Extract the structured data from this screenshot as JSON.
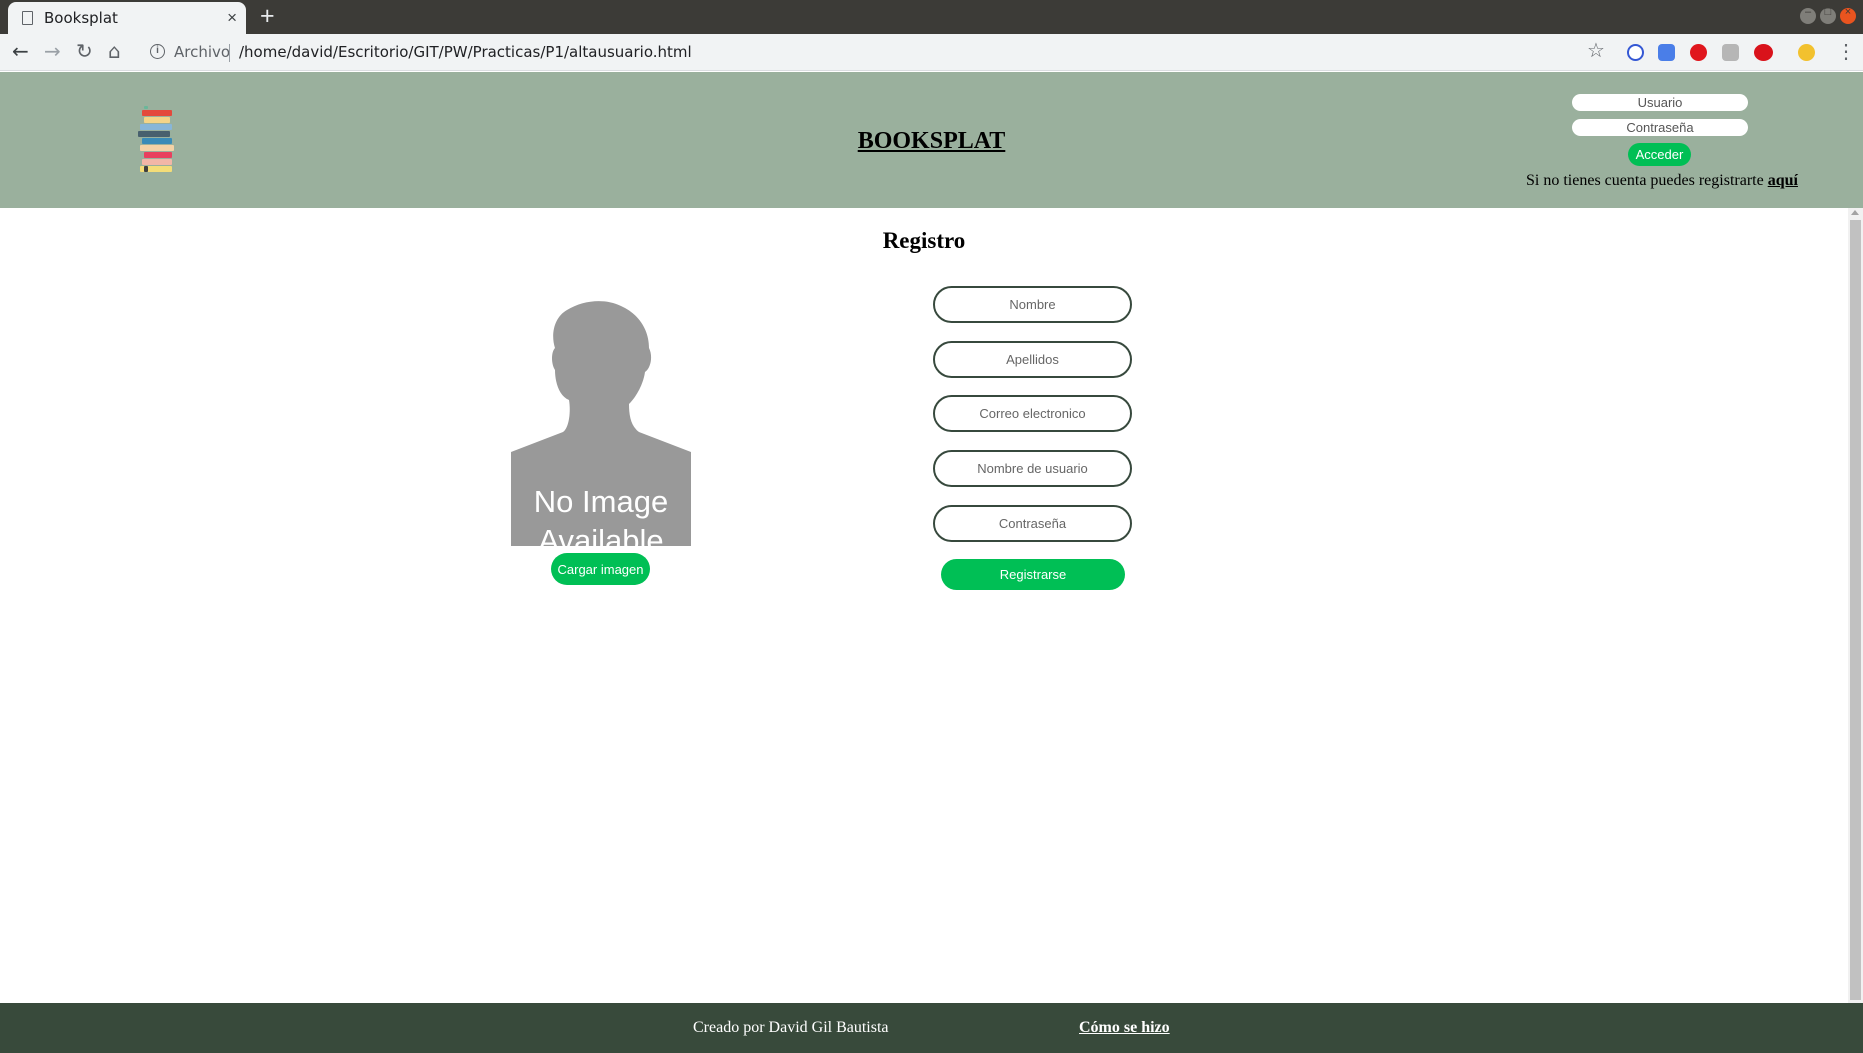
{
  "browser": {
    "tab_title": "Booksplat",
    "tab_close": "×",
    "new_tab": "+",
    "scheme_label": "Archivo",
    "url": "/home/david/Escritorio/GIT/PW/Practicas/P1/altausuario.html",
    "icons": [
      "document-icon",
      "back-icon",
      "forward-icon",
      "reload-icon",
      "home-icon",
      "info-icon",
      "star-icon",
      "menu-icon"
    ]
  },
  "header": {
    "site_title": "BOOKSPLAT",
    "login": {
      "user_placeholder": "Usuario",
      "password_placeholder": "Contraseña",
      "submit_label": "Acceder"
    },
    "register_hint": "Si no tienes cuenta puedes registrarte ",
    "register_link": "aquí"
  },
  "main": {
    "title": "Registro",
    "avatar": {
      "line1": "No Image",
      "line2": "Available",
      "upload_label": "Cargar imagen"
    },
    "form": {
      "fields": [
        {
          "placeholder": "Nombre"
        },
        {
          "placeholder": "Apellidos"
        },
        {
          "placeholder": "Correo electronico"
        },
        {
          "placeholder": "Nombre de usuario"
        },
        {
          "placeholder": "Contraseña"
        }
      ],
      "submit_label": "Registrarse"
    }
  },
  "footer": {
    "credit": "Creado por David Gil Bautista",
    "link": "Cómo se hizo"
  },
  "colors": {
    "header_bg": "#9ab09d",
    "footer_bg": "#384a3b",
    "accent_green": "#00bf55",
    "field_border": "#37493d"
  }
}
